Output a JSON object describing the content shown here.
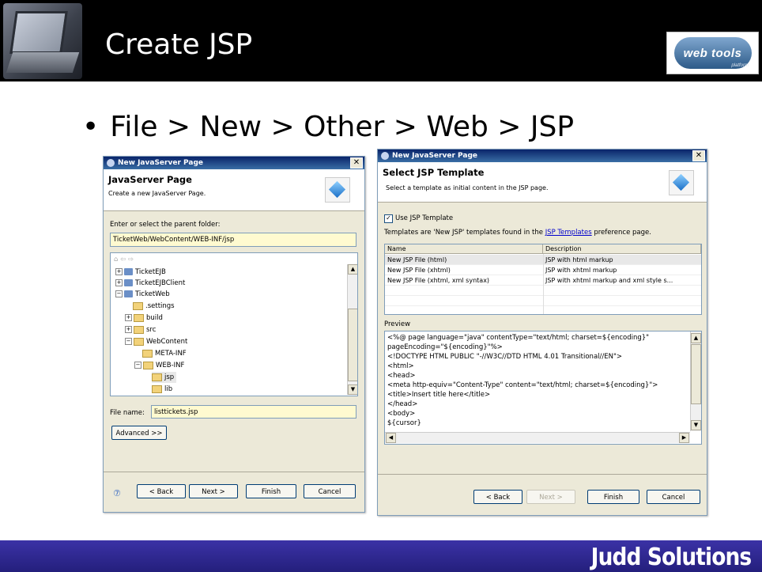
{
  "slide": {
    "title": "Create JSP",
    "bullet": "File > New > Other > Web > JSP",
    "logo_text": "web tools",
    "logo_sub": "platform",
    "footer": "Judd Solutions"
  },
  "dialog1": {
    "window_title": "New JavaServer Page",
    "header_title": "JavaServer Page",
    "header_subtitle": "Create a new JavaServer Page.",
    "folder_label": "Enter or select the parent folder:",
    "folder_value": "TicketWeb/WebContent/WEB-INF/jsp",
    "tree": [
      {
        "label": "TicketEJB"
      },
      {
        "label": "TicketEJBClient"
      },
      {
        "label": "TicketWeb"
      },
      {
        "label": ".settings"
      },
      {
        "label": "build"
      },
      {
        "label": "src"
      },
      {
        "label": "WebContent"
      },
      {
        "label": "META-INF"
      },
      {
        "label": "WEB-INF"
      },
      {
        "label": "jsp"
      },
      {
        "label": "lib"
      }
    ],
    "filename_label": "File name:",
    "filename_value": "listtickets.jsp",
    "advanced": "Advanced >>",
    "buttons": {
      "back": "< Back",
      "next": "Next >",
      "finish": "Finish",
      "cancel": "Cancel"
    }
  },
  "dialog2": {
    "window_title": "New JavaServer Page",
    "header_title": "Select JSP Template",
    "header_subtitle": "Select a template as initial content in the JSP page.",
    "use_template": "Use JSP Template",
    "templates_prefix": "Templates are 'New JSP' templates found in the ",
    "templates_link": "JSP Templates",
    "templates_suffix": " preference page.",
    "columns": [
      "Name",
      "Description"
    ],
    "rows": [
      {
        "name": "New JSP File (html)",
        "desc": "JSP with html markup"
      },
      {
        "name": "New JSP File (xhtml)",
        "desc": "JSP with xhtml markup"
      },
      {
        "name": "New JSP File (xhtml, xml syntax)",
        "desc": "JSP with xhtml markup and xml style s..."
      }
    ],
    "preview_label": "Preview",
    "preview_lines": [
      "<%@ page language=\"java\" contentType=\"text/html; charset=${encoding}\"",
      "   pageEncoding=\"${encoding}\"%>",
      "<!DOCTYPE HTML PUBLIC \"-//W3C//DTD HTML 4.01 Transitional//EN\">",
      "<html>",
      "<head>",
      "<meta http-equiv=\"Content-Type\" content=\"text/html; charset=${encoding}\">",
      "<title>Insert title here</title>",
      "</head>",
      "<body>",
      "${cursor}"
    ],
    "buttons": {
      "back": "< Back",
      "next": "Next >",
      "finish": "Finish",
      "cancel": "Cancel"
    }
  }
}
